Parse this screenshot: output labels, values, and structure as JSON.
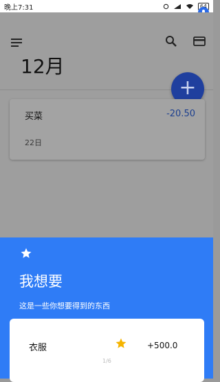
{
  "statusbar": {
    "time": "晚上7:31",
    "battery": "64"
  },
  "header": {
    "month": "12月"
  },
  "fab": {
    "label": "+"
  },
  "record": {
    "title": "买菜",
    "amount": "-20.50",
    "date": "22日"
  },
  "wish_sheet": {
    "title": "我想要",
    "subtitle": "这是一些你想要得到的东西",
    "item": {
      "name": "衣服",
      "amount": "+500.0"
    },
    "pager": "1/6"
  },
  "icons": [
    "menu-icon",
    "search-icon",
    "credit-card-icon",
    "star-icon",
    "wifi-icon",
    "signal-icon",
    "alarm-icon",
    "battery-icon"
  ],
  "colors": {
    "primary": "#2f7cf6",
    "fab": "#1f3f9e",
    "expense": "#1c3f8f",
    "star": "#f5b400"
  }
}
